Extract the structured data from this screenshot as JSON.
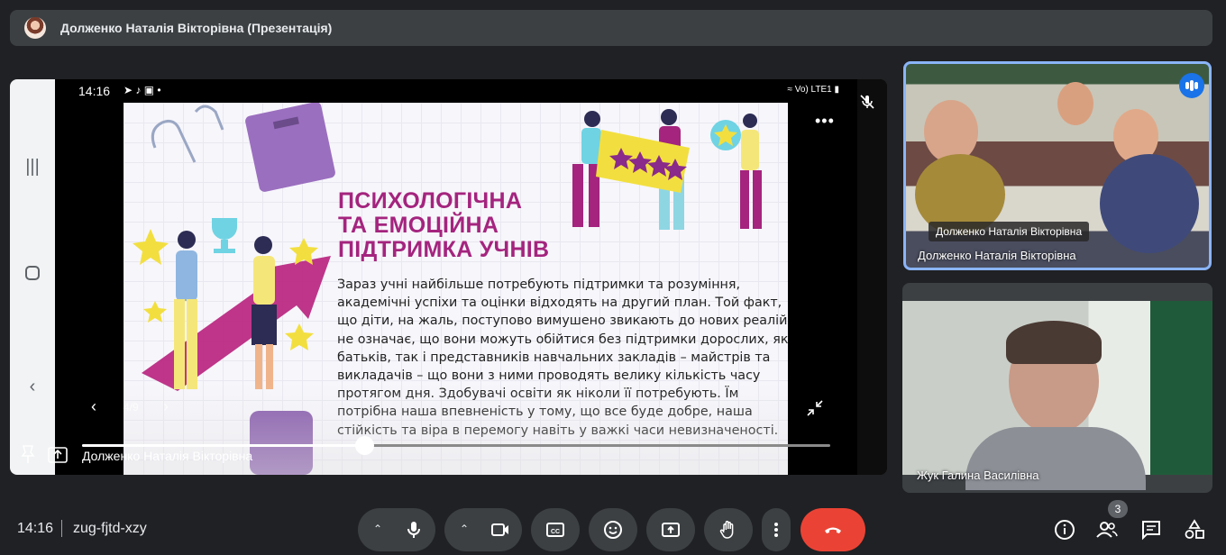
{
  "presenter_bar": {
    "title": "Долженко Наталія Вікторівна (Презентація)"
  },
  "device": {
    "time": "14:16",
    "status_right": "Vo) LTE1"
  },
  "slide": {
    "title_lines": [
      "ПСИХОЛОГІЧНА",
      "ТА ЕМОЦІЙНА",
      "ПІДТРИМКА УЧНІВ"
    ],
    "body_lines": [
      "Зараз учні найбільше потребують підтримки та розуміння,",
      "академічні успіхи та оцінки відходять на другий план. Той факт,",
      "що діти, на жаль, поступово вимушено звикають до нових реалій,",
      "не означає, що вони можуть обійтися без підтримки дорослих, як",
      "батьків, так і представників навчальних закладів – майстрів та",
      "викладачів – що вони з ними проводять велику кількість часу",
      "протягом дня. Здобувачі освіти як ніколи її потребують. Їм",
      "потрібна наша впевненість у тому, що все буде добре, наша",
      "стійкість та віра в перемогу навіть у важкі часи невизначеності."
    ]
  },
  "player": {
    "slide_counter": "4/9",
    "progress_fraction": 0.377
  },
  "stage": {
    "presenter_name": "Долженко Наталія Вікторівна"
  },
  "participants": [
    {
      "tag": "Долженко Наталія Вікторівна",
      "name": "Долженко Наталія Вікторівна"
    },
    {
      "name": "Жук Галина Василівна"
    }
  ],
  "meeting": {
    "time": "14:16",
    "code": "zug-fjtd-xzy",
    "people_count": "3"
  },
  "colors": {
    "end_call": "#ea4335",
    "control_bg": "#3c4043",
    "speaking_blue": "#1a73e8",
    "slide_magenta": "#a4247e"
  }
}
